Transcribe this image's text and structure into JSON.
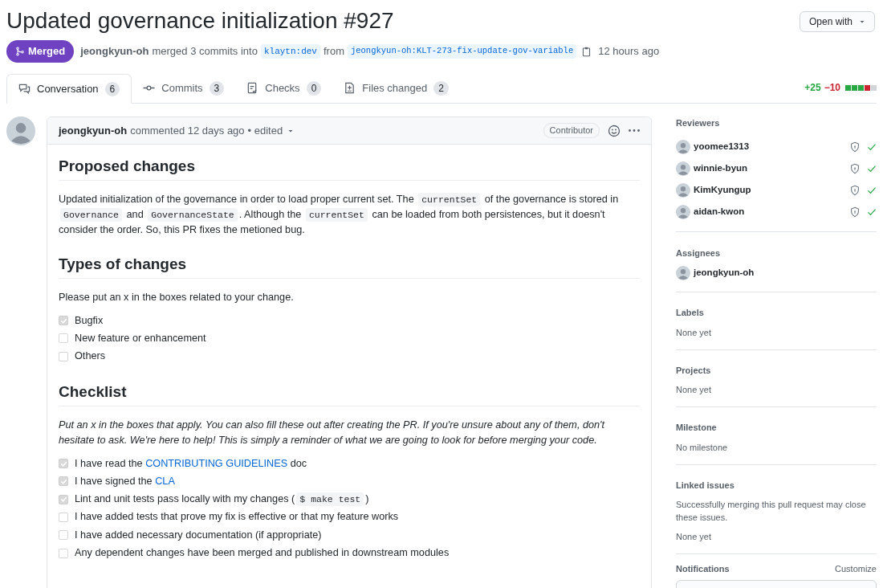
{
  "title": "Updated governance initialization",
  "number": "#927",
  "open_with": "Open with",
  "state_badge": {
    "label": "Merged",
    "kind": "merged"
  },
  "merge_info": {
    "author": "jeongkyun-oh",
    "action": "merged 3 commits into",
    "base_branch": "klaytn:dev",
    "from_word": "from",
    "head_branch": "jeongkyun-oh:KLT-273-fix-update-gov-variable",
    "time": "12 hours ago"
  },
  "tabs": [
    {
      "label": "Conversation",
      "count": "6",
      "selected": true
    },
    {
      "label": "Commits",
      "count": "3",
      "selected": false
    },
    {
      "label": "Checks",
      "count": "0",
      "selected": false
    },
    {
      "label": "Files changed",
      "count": "2",
      "selected": false
    }
  ],
  "diffstat": {
    "added": "+25",
    "removed": "−10",
    "blocks": [
      {
        "color": "#28a745"
      },
      {
        "color": "#28a745"
      },
      {
        "color": "#28a745"
      },
      {
        "color": "#cb2431"
      },
      {
        "color": "#d1d5da"
      }
    ]
  },
  "comment": {
    "author": "jeongkyun-oh",
    "meta": "commented 12 days ago",
    "edited": "• edited",
    "role": "Contributor",
    "sections": [
      {
        "heading": "Proposed changes",
        "blocks": [
          {
            "kind": "paragraph",
            "segments": [
              {
                "kind": "text",
                "text": "Updated initialization of the governance in order to load proper current set. The "
              },
              {
                "kind": "code",
                "text": "currentSet"
              },
              {
                "kind": "text",
                "text": " of the governance is stored in "
              },
              {
                "kind": "code",
                "text": "Governance"
              },
              {
                "kind": "text",
                "text": " and "
              },
              {
                "kind": "code",
                "text": "GovernanceState"
              },
              {
                "kind": "text",
                "text": ". Although the "
              },
              {
                "kind": "code",
                "text": "currentSet"
              },
              {
                "kind": "text",
                "text": " can be loaded from both persistences, but it doesn't consider the order. So, this PR fixes the metioned bug."
              }
            ]
          }
        ]
      },
      {
        "heading": "Types of changes",
        "blocks": [
          {
            "kind": "paragraph",
            "segments": [
              {
                "kind": "text",
                "text": "Please put an x in the boxes related to your change."
              }
            ]
          },
          {
            "kind": "task",
            "checked": true,
            "segments": [
              {
                "kind": "text",
                "text": "Bugfix"
              }
            ]
          },
          {
            "kind": "task",
            "checked": false,
            "segments": [
              {
                "kind": "text",
                "text": "New feature or enhancement"
              }
            ]
          },
          {
            "kind": "task",
            "checked": false,
            "segments": [
              {
                "kind": "text",
                "text": "Others"
              }
            ]
          }
        ]
      },
      {
        "heading": "Checklist",
        "blocks": [
          {
            "kind": "note",
            "segments": [
              {
                "kind": "text",
                "text": "Put an x in the boxes that apply. You can also fill these out after creating the PR. If you're unsure about any of them, don't hesitate to ask. We're here to help! This is simply a reminder of what we are going to look for before merging your code."
              }
            ]
          },
          {
            "kind": "task",
            "checked": true,
            "segments": [
              {
                "kind": "text",
                "text": "I have read the "
              },
              {
                "kind": "link",
                "text": "CONTRIBUTING GUIDELINES"
              },
              {
                "kind": "text",
                "text": " doc"
              }
            ]
          },
          {
            "kind": "task",
            "checked": true,
            "segments": [
              {
                "kind": "text",
                "text": "I have signed the "
              },
              {
                "kind": "link",
                "text": "CLA"
              }
            ]
          },
          {
            "kind": "task",
            "checked": true,
            "segments": [
              {
                "kind": "text",
                "text": "Lint and unit tests pass locally with my changes ("
              },
              {
                "kind": "code",
                "text": "$ make test"
              },
              {
                "kind": "text",
                "text": ")"
              }
            ]
          },
          {
            "kind": "task",
            "checked": false,
            "segments": [
              {
                "kind": "text",
                "text": "I have added tests that prove my fix is effective or that my feature works"
              }
            ]
          },
          {
            "kind": "task",
            "checked": false,
            "segments": [
              {
                "kind": "text",
                "text": "I have added necessary documentation (if appropriate)"
              }
            ]
          },
          {
            "kind": "task",
            "checked": false,
            "segments": [
              {
                "kind": "text",
                "text": "Any dependent changes have been merged and published in downstream modules"
              }
            ]
          }
        ]
      }
    ]
  },
  "sidebar": {
    "reviewers": {
      "title": "Reviewers",
      "items": [
        {
          "name": "yoomee1313",
          "approved": true
        },
        {
          "name": "winnie-byun",
          "approved": true
        },
        {
          "name": "KimKyungup",
          "approved": true
        },
        {
          "name": "aidan-kwon",
          "approved": true
        }
      ]
    },
    "assignees": {
      "title": "Assignees",
      "items": [
        {
          "name": "jeongkyun-oh"
        }
      ]
    },
    "sections": [
      {
        "title": "Labels",
        "lines": [
          "None yet"
        ]
      },
      {
        "title": "Projects",
        "lines": [
          "None yet"
        ]
      },
      {
        "title": "Milestone",
        "lines": [
          "No milestone"
        ]
      },
      {
        "title": "Linked issues",
        "lines": [
          "Successfully merging this pull request may close these issues.",
          "None yet"
        ]
      }
    ],
    "notifications": {
      "title": "Notifications",
      "action": "Customize"
    }
  }
}
